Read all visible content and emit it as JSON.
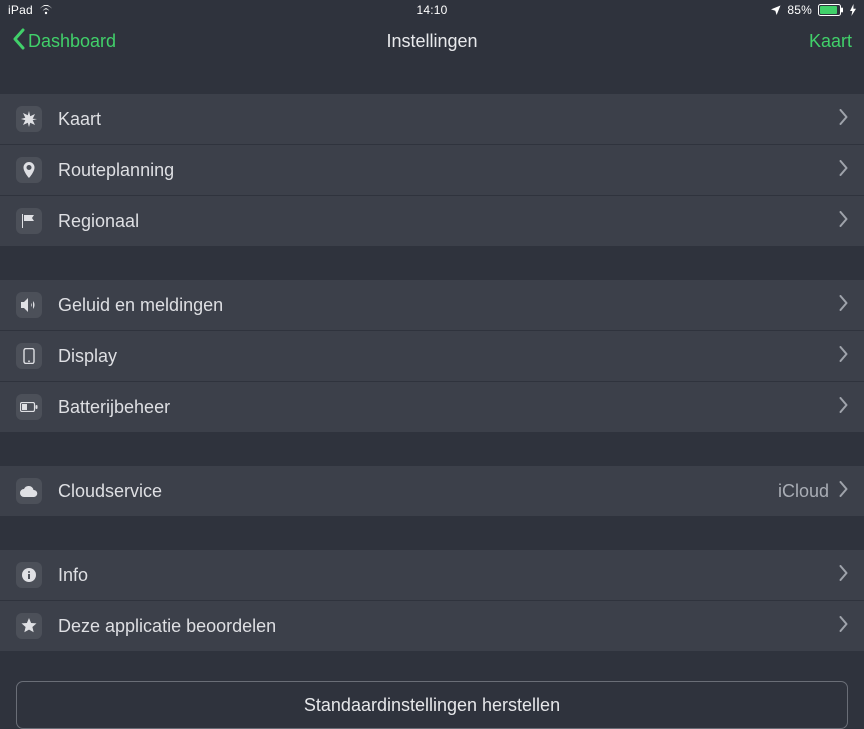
{
  "statusbar": {
    "device": "iPad",
    "time": "14:10",
    "battery_pct": "85%"
  },
  "nav": {
    "back_label": "Dashboard",
    "title": "Instellingen",
    "right_label": "Kaart"
  },
  "groups": [
    [
      {
        "icon": "compass-star-icon",
        "label": "Kaart"
      },
      {
        "icon": "pin-icon",
        "label": "Routeplanning"
      },
      {
        "icon": "flag-icon",
        "label": "Regionaal"
      }
    ],
    [
      {
        "icon": "speaker-icon",
        "label": "Geluid en meldingen"
      },
      {
        "icon": "device-icon",
        "label": "Display"
      },
      {
        "icon": "battery-icon",
        "label": "Batterijbeheer"
      }
    ],
    [
      {
        "icon": "cloud-icon",
        "label": "Cloudservice",
        "detail": "iCloud"
      }
    ],
    [
      {
        "icon": "info-icon",
        "label": "Info"
      },
      {
        "icon": "star-icon",
        "label": "Deze applicatie beoordelen"
      }
    ]
  ],
  "reset_btn_label": "Standaardinstellingen herstellen"
}
